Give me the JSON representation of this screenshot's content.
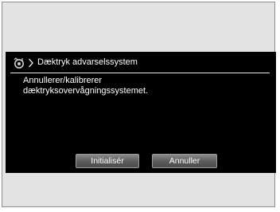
{
  "header": {
    "icon": "tire-pressure-icon",
    "chevron": "chevron-right-icon",
    "title": "Dæktryk advarselssystem"
  },
  "message": {
    "line1": "Annullerer/kalibrerer",
    "line2": "dæktryksovervågningssystemet."
  },
  "buttons": {
    "initialize": "Initialisér",
    "cancel": "Annuller"
  },
  "colors": {
    "screen_background": "#000000",
    "outer_background": "#e3e3e3",
    "text": "#ffffff"
  }
}
